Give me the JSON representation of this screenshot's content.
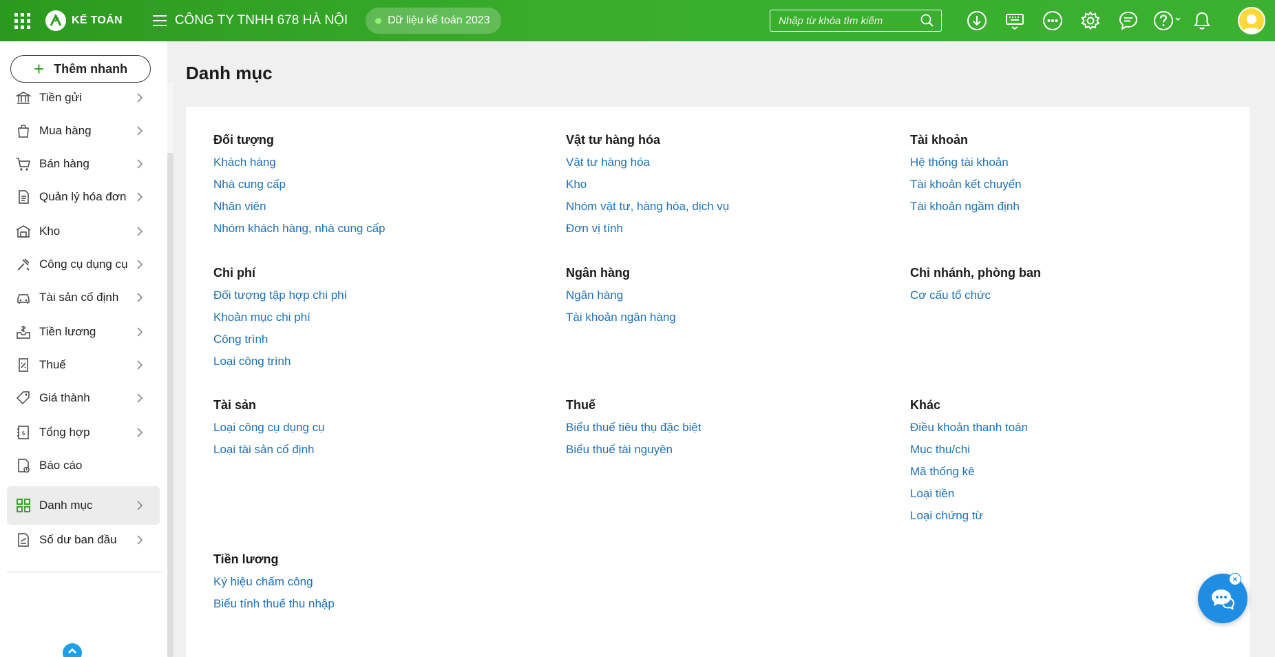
{
  "header": {
    "app_name": "KẾ TOÁN",
    "company": "CÔNG TY TNHH 678 HÀ NỘI",
    "data_year": "Dữ liệu kế toán 2023",
    "search_placeholder": "Nhập từ khóa tìm kiếm",
    "icons": [
      "download-icon",
      "keyboard-icon",
      "more-icon",
      "settings-icon",
      "chat-icon",
      "help-icon",
      "bell-icon"
    ]
  },
  "sidebar": {
    "quick_add": "Thêm nhanh",
    "items": [
      {
        "label": "Tiền gửi",
        "icon": "bank-icon"
      },
      {
        "label": "Mua hàng",
        "icon": "shopping-bag-icon"
      },
      {
        "label": "Bán hàng",
        "icon": "cart-icon"
      },
      {
        "label": "Quản lý hóa đơn",
        "icon": "invoice-icon"
      },
      {
        "label": "Kho",
        "icon": "warehouse-icon"
      },
      {
        "label": "Công cụ dụng cụ",
        "icon": "tools-icon"
      },
      {
        "label": "Tài sản cố định",
        "icon": "car-icon"
      },
      {
        "label": "Tiền lương",
        "icon": "salary-icon"
      },
      {
        "label": "Thuế",
        "icon": "tax-icon"
      },
      {
        "label": "Giá thành",
        "icon": "price-tag-icon"
      },
      {
        "label": "Tổng hợp",
        "icon": "summary-icon"
      },
      {
        "label": "Báo cáo",
        "icon": "report-icon"
      },
      {
        "label": "Danh mục",
        "icon": "grid-icon"
      },
      {
        "label": "Số dư ban đầu",
        "icon": "balance-icon"
      }
    ],
    "active": "Danh mục"
  },
  "main": {
    "title": "Danh mục",
    "groups": [
      {
        "title": "Đối tượng",
        "links": [
          "Khách hàng",
          "Nhà cung cấp",
          "Nhân viên",
          "Nhóm khách hàng, nhà cung cấp"
        ]
      },
      {
        "title": "Vật tư hàng hóa",
        "links": [
          "Vật tư hàng hóa",
          "Kho",
          "Nhóm vật tư, hàng hóa, dịch vụ",
          "Đơn vị tính"
        ]
      },
      {
        "title": "Tài khoản",
        "links": [
          "Hệ thống tài khoản",
          "Tài khoản kết chuyển",
          "Tài khoản ngầm định"
        ]
      },
      {
        "title": "Chi phí",
        "links": [
          "Đối tượng tập hợp chi phí",
          "Khoản mục chi phí",
          "Công trình",
          "Loại công trình"
        ]
      },
      {
        "title": "Ngân hàng",
        "links": [
          "Ngân hàng",
          "Tài khoản ngân hàng"
        ]
      },
      {
        "title": "Chi nhánh, phòng ban",
        "links": [
          "Cơ cấu tổ chức"
        ]
      },
      {
        "title": "Tài sản",
        "links": [
          "Loại công cụ dụng cụ",
          "Loại tài sản cố định"
        ]
      },
      {
        "title": "Thuế",
        "links": [
          "Biểu thuế tiêu thụ đặc biệt",
          "Biểu thuế tài nguyên"
        ]
      },
      {
        "title": "Khác",
        "links": [
          "Điều khoản thanh toán",
          "Mục thu/chi",
          "Mã thống kê",
          "Loại tiền",
          "Loại chứng từ"
        ]
      },
      {
        "title": "Tiền lương",
        "links": [
          "Ký hiệu chấm công",
          "Biểu tính thuế thu nhập"
        ]
      }
    ]
  },
  "colors": {
    "header_green": "#3aad2c",
    "link_blue": "#1d6fb8",
    "chat_blue": "#1f8de3"
  }
}
